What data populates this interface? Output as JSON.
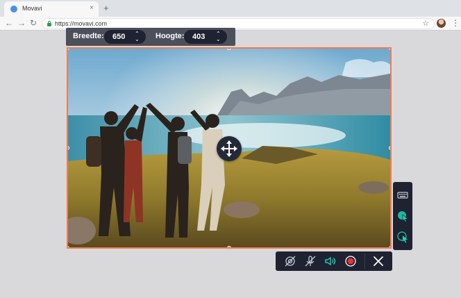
{
  "browser": {
    "tab_title": "Movavi",
    "close_glyph": "×",
    "new_tab_glyph": "+",
    "back_glyph": "←",
    "forward_glyph": "→",
    "reload_glyph": "↻",
    "url": "https://movavi.com",
    "bookmark_glyph": "☆",
    "menu_glyph": "⋮"
  },
  "dimensions": {
    "width_label": "Breedte:",
    "width_value": "650",
    "height_label": "Hoogte:",
    "height_value": "403"
  },
  "colors": {
    "selection_border": "#f27b50",
    "panel_bg": "#1f2230",
    "active_teal": "#1fd1b4",
    "record_red": "#e8313c"
  },
  "side_panel": {
    "items": [
      "keyboard-icon",
      "cursor-highlight-icon",
      "click-effect-icon"
    ]
  },
  "controls": {
    "items": [
      "webcam-off-icon",
      "microphone-off-icon",
      "system-audio-icon",
      "record-icon",
      "close-icon"
    ]
  }
}
